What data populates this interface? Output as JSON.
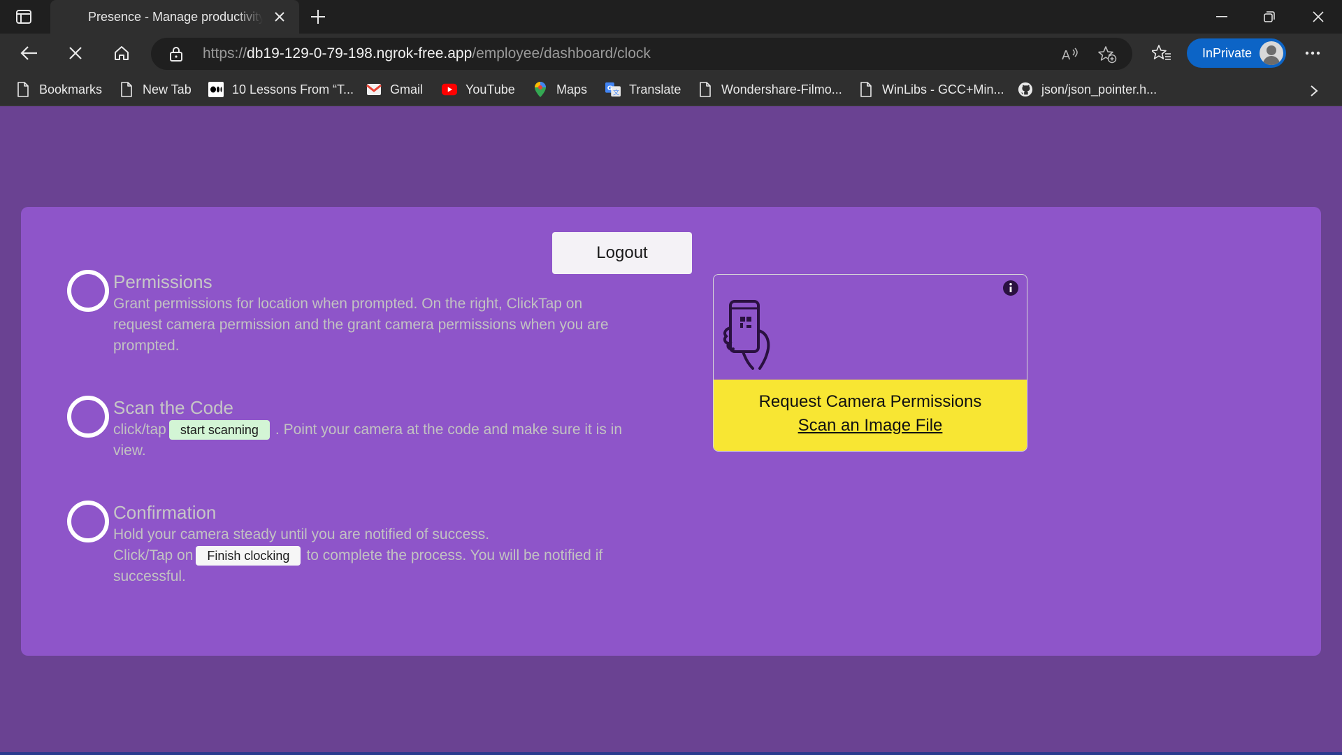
{
  "browser": {
    "tab": {
      "title": "Presence - Manage productivity with ease"
    },
    "url": {
      "scheme": "https://",
      "host": "db19-129-0-79-198.ngrok-free.app",
      "path": "/employee/dashboard/clock"
    },
    "inprivate_label": "InPrivate",
    "bookmarks": [
      {
        "label": "Bookmarks",
        "icon": "page-icon"
      },
      {
        "label": "New Tab",
        "icon": "page-icon"
      },
      {
        "label": "10 Lessons From “T...",
        "icon": "medium-icon"
      },
      {
        "label": "Gmail",
        "icon": "gmail-icon"
      },
      {
        "label": "YouTube",
        "icon": "youtube-icon"
      },
      {
        "label": "Maps",
        "icon": "maps-icon"
      },
      {
        "label": "Translate",
        "icon": "translate-icon"
      },
      {
        "label": "Wondershare-Filmo...",
        "icon": "page-icon"
      },
      {
        "label": "WinLibs - GCC+Min...",
        "icon": "page-icon"
      },
      {
        "label": "json/json_pointer.h...",
        "icon": "github-icon"
      }
    ]
  },
  "page": {
    "logout_label": "Logout",
    "steps": [
      {
        "title": "Permissions",
        "text": "Grant permissions for location when prompted. On the right, ClickTap on request camera permission and the grant camera permissions when you are prompted."
      },
      {
        "title": "Scan the Code",
        "text_before": "click/tap",
        "button": "start scanning",
        "text_after": ". Point your camera at the code and make sure it is in view."
      },
      {
        "title": "Confirmation",
        "text_line1": "Hold your camera steady until you are notified of success.",
        "text_before": "Click/Tap on",
        "button": "Finish clocking",
        "text_after": "to complete the process. You will be notified if successful."
      }
    ],
    "scanner": {
      "request_label": "Request Camera Permissions",
      "scan_file_label": "Scan an Image File"
    }
  },
  "colors": {
    "outer_bg": "#6a4292",
    "card_bg": "#8e55c9",
    "scanner_button_bg": "#f8e633",
    "inprivate_bg": "#0c64c6"
  }
}
